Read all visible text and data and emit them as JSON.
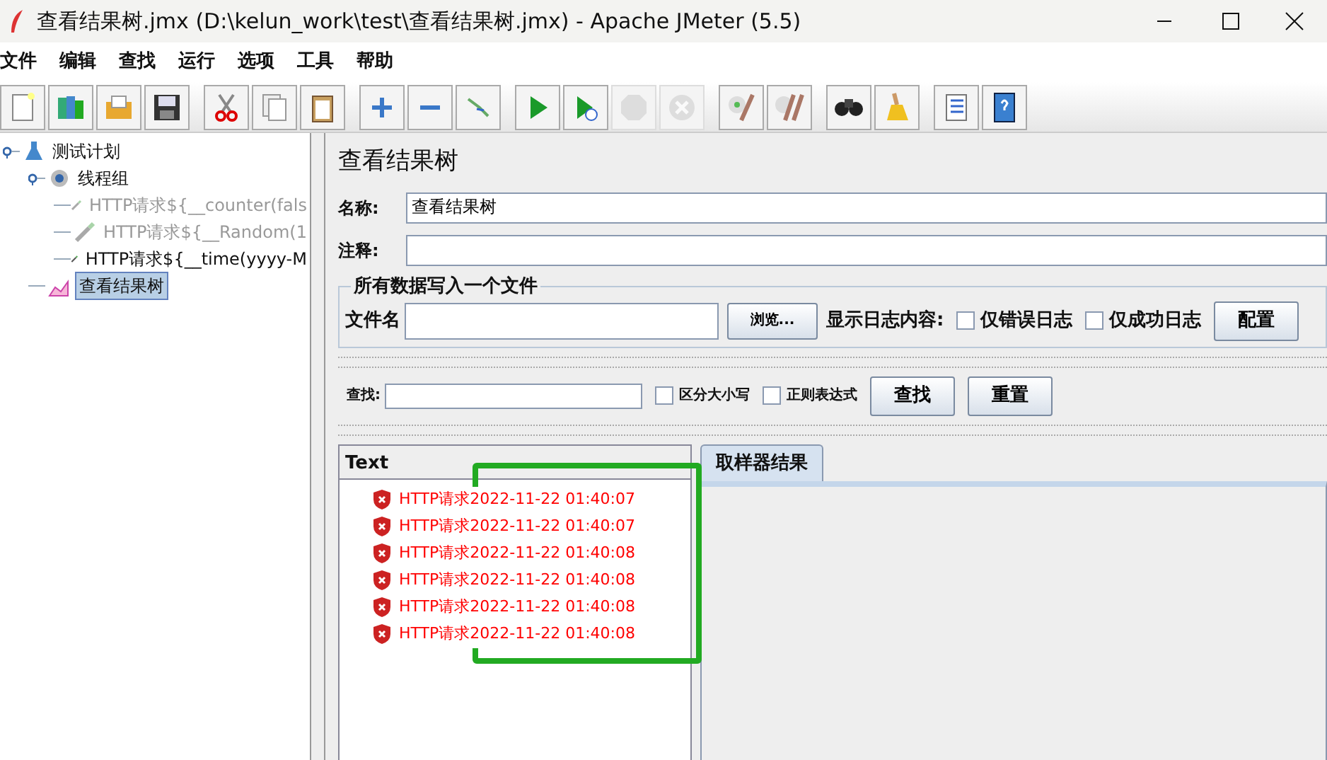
{
  "window": {
    "title": "查看结果树.jmx (D:\\kelun_work\\test\\查看结果树.jmx) - Apache JMeter (5.5)"
  },
  "menu": [
    "文件",
    "编辑",
    "查找",
    "运行",
    "选项",
    "工具",
    "帮助"
  ],
  "toolbar": [
    {
      "kind": "new",
      "disabled": false
    },
    {
      "kind": "templates",
      "disabled": false
    },
    {
      "kind": "open",
      "disabled": false
    },
    {
      "kind": "save",
      "disabled": false
    },
    {
      "kind": "sep"
    },
    {
      "kind": "cut",
      "disabled": false
    },
    {
      "kind": "copy",
      "disabled": false
    },
    {
      "kind": "paste",
      "disabled": false
    },
    {
      "kind": "sep"
    },
    {
      "kind": "expand",
      "disabled": false
    },
    {
      "kind": "collapse",
      "disabled": false
    },
    {
      "kind": "toggle",
      "disabled": false
    },
    {
      "kind": "sep"
    },
    {
      "kind": "start",
      "disabled": false
    },
    {
      "kind": "start-no-pause",
      "disabled": false
    },
    {
      "kind": "stop",
      "disabled": true
    },
    {
      "kind": "shutdown",
      "disabled": true
    },
    {
      "kind": "sep"
    },
    {
      "kind": "clear",
      "disabled": false
    },
    {
      "kind": "clear-all",
      "disabled": false
    },
    {
      "kind": "sep"
    },
    {
      "kind": "search",
      "disabled": false
    },
    {
      "kind": "reset-search",
      "disabled": false
    },
    {
      "kind": "sep"
    },
    {
      "kind": "functions",
      "disabled": false
    },
    {
      "kind": "help",
      "disabled": false
    }
  ],
  "tree": [
    {
      "label": "测试计划",
      "kind": "plan",
      "selected": false,
      "disabled": false,
      "expanded": true,
      "children": [
        {
          "label": "线程组",
          "kind": "threads",
          "selected": false,
          "disabled": false,
          "expanded": true,
          "children": [
            {
              "label": "HTTP请求${__counter(fals",
              "kind": "sampler",
              "selected": false,
              "disabled": true
            },
            {
              "label": "HTTP请求${__Random(1",
              "kind": "sampler",
              "selected": false,
              "disabled": true
            },
            {
              "label": "HTTP请求${__time(yyyy-M",
              "kind": "sampler",
              "selected": false,
              "disabled": false
            }
          ]
        },
        {
          "label": "查看结果树",
          "kind": "listener",
          "selected": true,
          "disabled": false
        }
      ]
    }
  ],
  "panel": {
    "title": "查看结果树",
    "name": {
      "label": "名称:",
      "value": "查看结果树"
    },
    "comment": {
      "label": "注释:"
    },
    "file_group": {
      "legend": "所有数据写入一个文件",
      "file_label": "文件名",
      "browse": "浏览...",
      "log_label": "显示日志内容:",
      "checkboxes": [
        {
          "label": "仅错误日志",
          "checked": false
        },
        {
          "label": "仅成功日志",
          "checked": false
        }
      ],
      "configure": "配置"
    },
    "search": {
      "label": "查找:",
      "checkboxes": [
        {
          "label": "区分大小写",
          "checked": false
        },
        {
          "label": "正则表达式",
          "checked": false
        }
      ],
      "buttons": [
        "查找",
        "重置"
      ]
    },
    "results": {
      "renderer": "Text",
      "items": [
        {
          "label": "HTTP请求2022-11-22 01:40:07",
          "failed": true
        },
        {
          "label": "HTTP请求2022-11-22 01:40:07",
          "failed": true
        },
        {
          "label": "HTTP请求2022-11-22 01:40:08",
          "failed": true
        },
        {
          "label": "HTTP请求2022-11-22 01:40:08",
          "failed": true
        },
        {
          "label": "HTTP请求2022-11-22 01:40:08",
          "failed": true
        },
        {
          "label": "HTTP请求2022-11-22 01:40:08",
          "failed": true
        }
      ]
    },
    "tabs": [
      {
        "label": "取样器结果",
        "selected": true
      }
    ]
  }
}
